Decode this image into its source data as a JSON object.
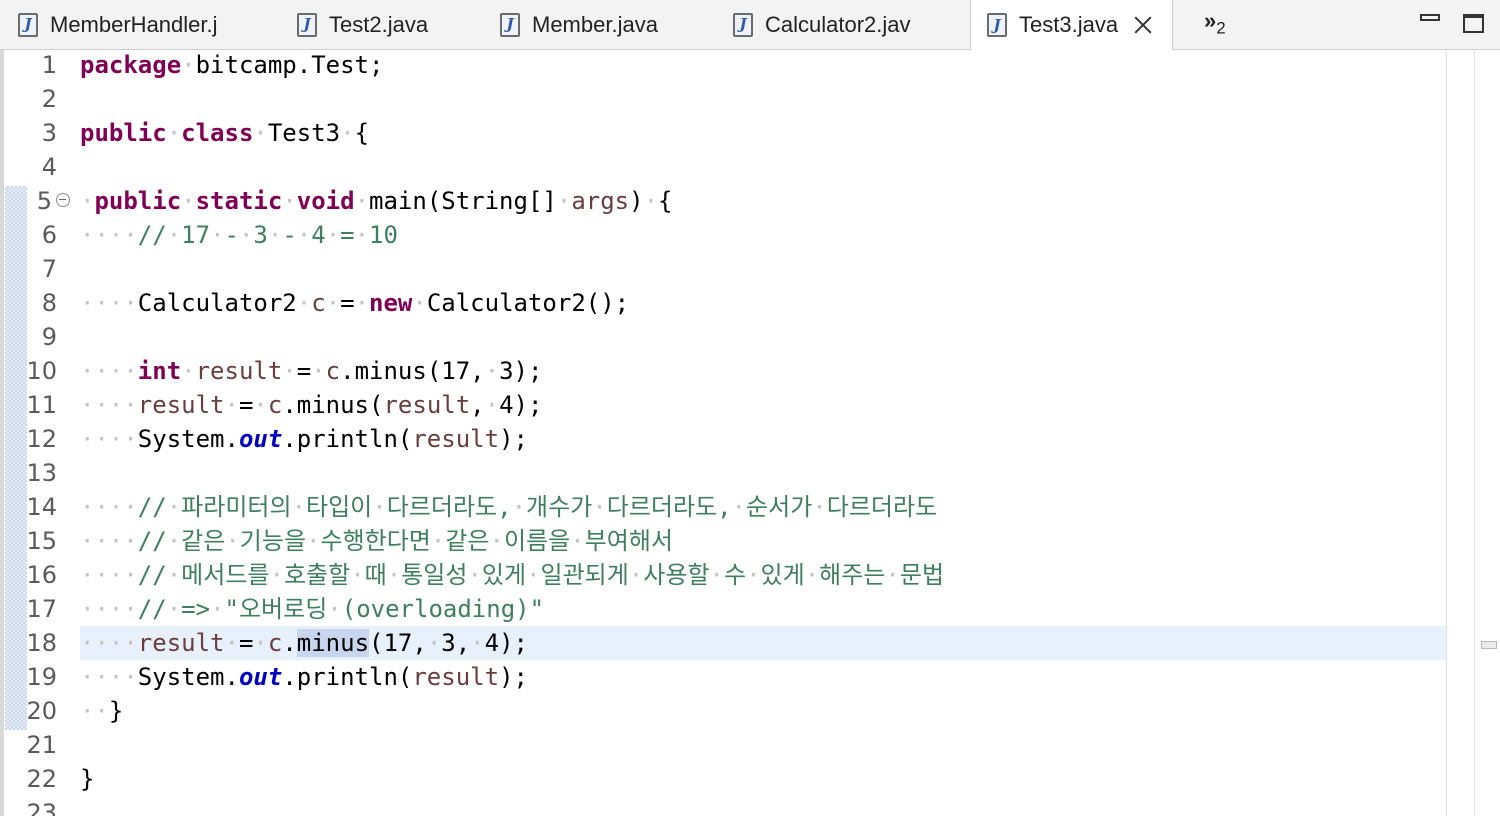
{
  "tabs": [
    {
      "label": "MemberHandler.j",
      "icon": "java-file-icon"
    },
    {
      "label": "Test2.java",
      "icon": "java-file-icon"
    },
    {
      "label": "Member.java",
      "icon": "java-file-icon"
    },
    {
      "label": "Calculator2.jav",
      "icon": "java-file-icon"
    },
    {
      "label": "Test3.java",
      "icon": "java-file-icon",
      "active": true
    }
  ],
  "overflow": {
    "chevron": "»",
    "count": "2"
  },
  "editor": {
    "lines": [
      {
        "num": "1",
        "text": "package bitcamp.Test;"
      },
      {
        "num": "2",
        "text": ""
      },
      {
        "num": "3",
        "text": "public class Test3 {"
      },
      {
        "num": "4",
        "text": ""
      },
      {
        "num": "5",
        "text": "  public static void main(String[] args) {"
      },
      {
        "num": "6",
        "text": "    // 17 - 3 - 4 = 10"
      },
      {
        "num": "7",
        "text": ""
      },
      {
        "num": "8",
        "text": "    Calculator2 c = new Calculator2();"
      },
      {
        "num": "9",
        "text": ""
      },
      {
        "num": "10",
        "text": "    int result = c.minus(17, 3);"
      },
      {
        "num": "11",
        "text": "    result = c.minus(result, 4);"
      },
      {
        "num": "12",
        "text": "    System.out.println(result);"
      },
      {
        "num": "13",
        "text": ""
      },
      {
        "num": "14",
        "text": "    // 파라미터의 타입이 다르더라도, 개수가 다르더라도, 순서가 다르더라도"
      },
      {
        "num": "15",
        "text": "    // 같은 기능을 수행한다면 같은 이름을 부여해서"
      },
      {
        "num": "16",
        "text": "    // 메서드를 호출할 때 통일성 있게 일관되게 사용할 수 있게 해주는 문법"
      },
      {
        "num": "17",
        "text": "    // => \"오버로딩 (overloading)\""
      },
      {
        "num": "18",
        "text": "    result = c.minus(17, 3, 4);"
      },
      {
        "num": "19",
        "text": "    System.out.println(result);"
      },
      {
        "num": "20",
        "text": "  }"
      },
      {
        "num": "21",
        "text": ""
      },
      {
        "num": "22",
        "text": "}"
      },
      {
        "num": "23",
        "text": ""
      }
    ],
    "current_line": "18",
    "colors": {
      "keyword": "#7f0055",
      "comment": "#3f7f5f",
      "local_variable": "#6a3e3e",
      "static_field": "#0000c0",
      "current_line_bg": "#e8f0fb",
      "selection": "#c7d6ee"
    }
  }
}
